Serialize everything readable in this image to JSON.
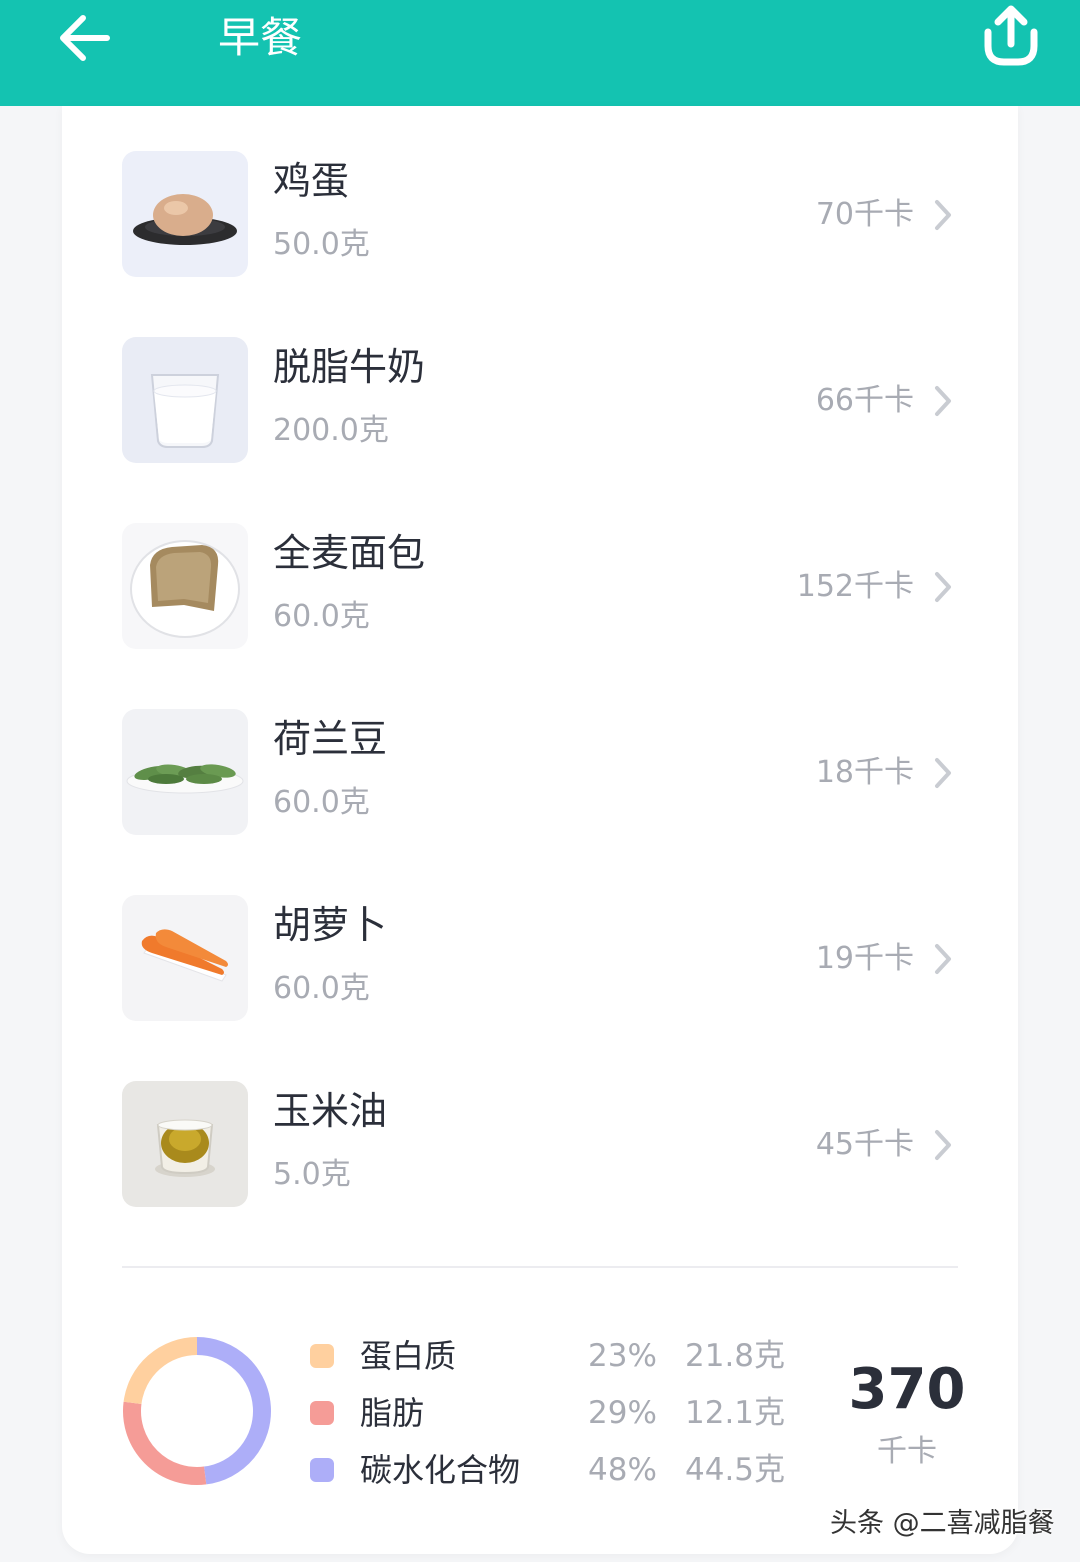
{
  "header": {
    "title": "早餐",
    "back_icon": "arrow-left-icon",
    "share_icon": "share-upload-icon",
    "color": "#14c3b1"
  },
  "foods": [
    {
      "name": "鸡蛋",
      "amount": "50.0克",
      "kcal": "70千卡",
      "image": "egg-photo"
    },
    {
      "name": "脱脂牛奶",
      "amount": "200.0克",
      "kcal": "66千卡",
      "image": "milk-glass-photo"
    },
    {
      "name": "全麦面包",
      "amount": "60.0克",
      "kcal": "152千卡",
      "image": "toast-photo"
    },
    {
      "name": "荷兰豆",
      "amount": "60.0克",
      "kcal": "18千卡",
      "image": "snow-peas-photo"
    },
    {
      "name": "胡萝卜",
      "amount": "60.0克",
      "kcal": "19千卡",
      "image": "carrots-photo"
    },
    {
      "name": "玉米油",
      "amount": "5.0克",
      "kcal": "45千卡",
      "image": "corn-oil-photo"
    }
  ],
  "nutrition": {
    "items": [
      {
        "label": "蛋白质",
        "percent": "23%",
        "grams": "21.8克",
        "color": "#ffd09f",
        "fraction": 0.23
      },
      {
        "label": "脂肪",
        "percent": "29%",
        "grams": "12.1克",
        "color": "#f59c97",
        "fraction": 0.29
      },
      {
        "label": "碳水化合物",
        "percent": "48%",
        "grams": "44.5克",
        "color": "#adaef8",
        "fraction": 0.48
      }
    ],
    "total_value": "370",
    "total_unit": "千卡"
  },
  "watermark": "头条 @二喜减脂餐"
}
